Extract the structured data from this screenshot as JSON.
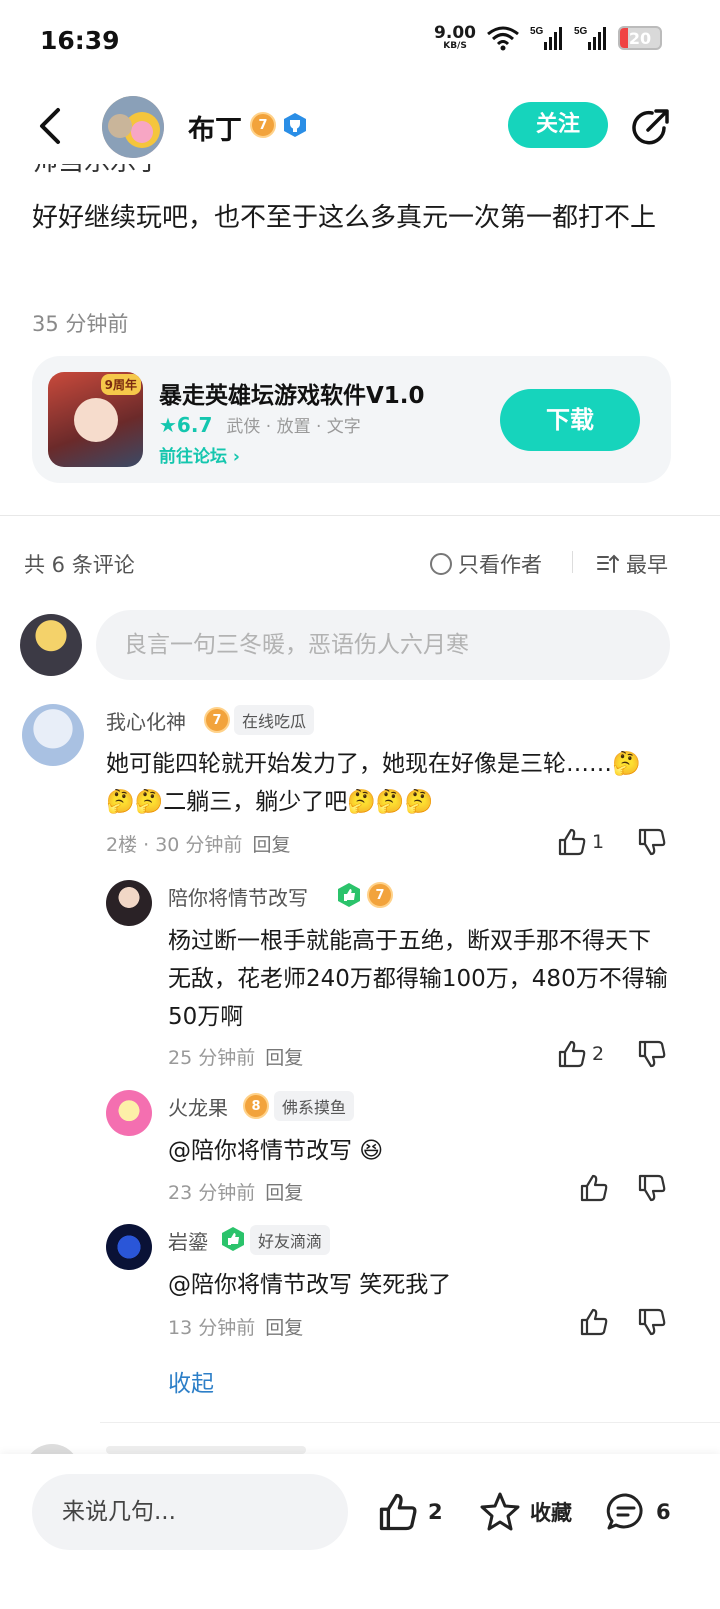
{
  "status_bar": {
    "time": "16:39",
    "net_speed": "9.00",
    "net_unit": "KB/S",
    "battery": "20",
    "battery_level": 0.2
  },
  "nav": {
    "author_name": "布丁",
    "author_level": "7",
    "follow_label": "关注"
  },
  "post": {
    "cut_text": "帅当乐乐了",
    "body": "好好继续玩吧，也不至于这么多真元一次第一都打不上",
    "time": "35 分钟前"
  },
  "game_card": {
    "icon_tag": "9周年",
    "title": "暴走英雄坛游戏软件V1.0",
    "rating": "★6.7",
    "tags": "武侠 · 放置 · 文字",
    "forum_link": "前往论坛 ›",
    "download_label": "下载"
  },
  "comments_header": {
    "count": "共 6 条评论",
    "only_author": "只看作者",
    "sort": "最早"
  },
  "comment_input_placeholder": "良言一句三冬暖，恶语伤人六月寒",
  "comments": [
    {
      "name": "我心化神",
      "level": "7",
      "tag": "在线吃瓜",
      "text": "她可能四轮就开始发力了，她现在好像是三轮……🤔🤔🤔二躺三，躺少了吧🤔🤔🤔",
      "meta": "2楼 · 30 分钟前",
      "reply": "回复",
      "likes": "1"
    },
    {
      "name": "陪你将情节改写",
      "level": "7",
      "text": "杨过断一根手就能高于五绝，断双手那不得天下无敌，花老师240万都得输100万，480万不得输50万啊",
      "meta": "25 分钟前",
      "reply": "回复",
      "likes": "2"
    },
    {
      "name": "火龙果",
      "level": "8",
      "tag": "佛系摸鱼",
      "text": "@陪你将情节改写 😆",
      "meta": "23 分钟前",
      "reply": "回复",
      "likes": ""
    },
    {
      "name": "岩鎏",
      "tag": "好友滴滴",
      "text": "@陪你将情节改写 笑死我了",
      "meta": "13 分钟前",
      "reply": "回复",
      "likes": ""
    }
  ],
  "collapse_label": "收起",
  "bottom_bar": {
    "input_placeholder": "来说几句...",
    "likes": "2",
    "collect_label": "收藏",
    "comments": "6"
  },
  "colors": {
    "accent": "#16d4bc",
    "link": "#2d7fc8",
    "level_badge": "#f2a33c",
    "battery_low": "#f04343"
  }
}
